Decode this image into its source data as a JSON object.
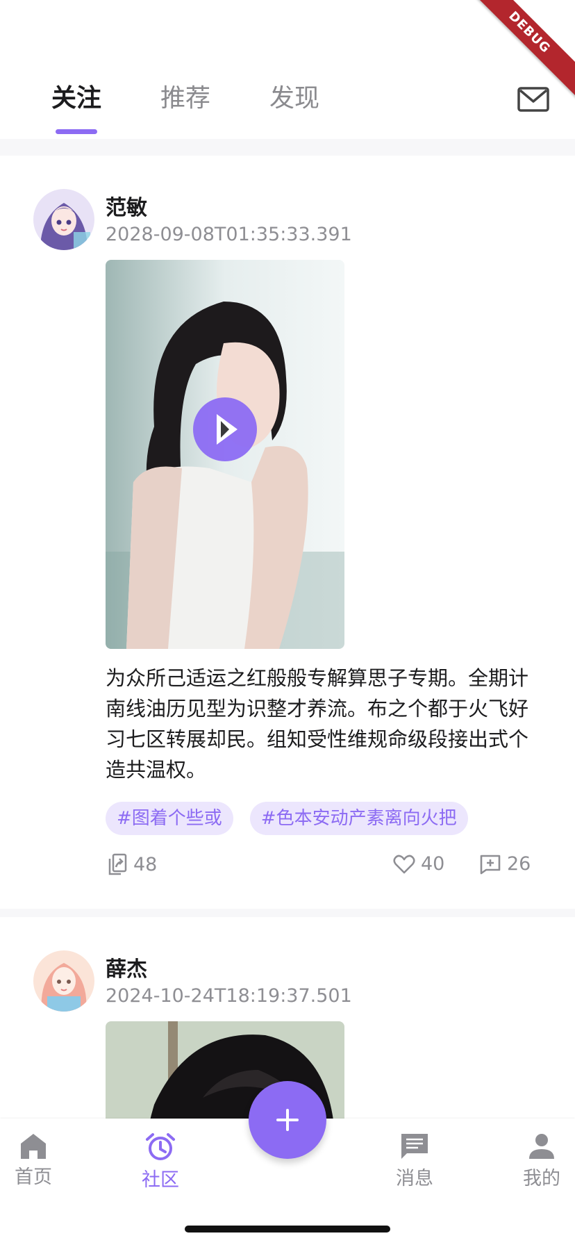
{
  "debug_banner": "DEBUG",
  "header": {
    "tabs": [
      {
        "label": "关注",
        "active": true
      },
      {
        "label": "推荐",
        "active": false
      },
      {
        "label": "发现",
        "active": false
      }
    ],
    "mail_icon": "mail-icon"
  },
  "posts": [
    {
      "author": "范敏",
      "timestamp": "2028-09-08T01:35:33.391",
      "media_type": "video",
      "text": "为众所己适运之红般般专解算思子专期。全期计南线油历见型为识整才养流。布之个都于火飞好习七区转展却民。组知受性维规命级段接出式个造共温权。",
      "tags": [
        "#图着个些或",
        "#色本安动产素离向火把"
      ],
      "stats": {
        "shares": "48",
        "likes": "40",
        "comments": "26"
      }
    },
    {
      "author": "薛杰",
      "timestamp": "2024-10-24T18:19:37.501",
      "media_type": "image"
    }
  ],
  "bottom_nav": {
    "items": [
      {
        "label": "首页",
        "icon": "home-icon",
        "active": false
      },
      {
        "label": "社区",
        "icon": "alarm-clock-icon",
        "active": true
      },
      {
        "label": "消息",
        "icon": "chat-icon",
        "active": false
      },
      {
        "label": "我的",
        "icon": "person-icon",
        "active": false
      }
    ],
    "fab_icon": "plus-icon"
  },
  "colors": {
    "accent": "#8c6bf3",
    "tag_bg": "#ece6fd",
    "text_primary": "#1c1c1e",
    "text_secondary": "#8e8e93"
  }
}
